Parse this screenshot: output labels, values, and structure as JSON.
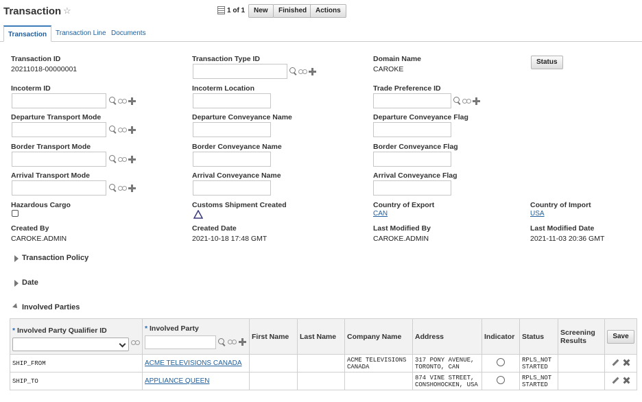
{
  "header": {
    "title": "Transaction",
    "record_nav": "1 of 1",
    "buttons": {
      "new": "New",
      "finished": "Finished",
      "actions": "Actions"
    }
  },
  "tabs": [
    "Transaction",
    "Transaction Line",
    "Documents"
  ],
  "form": {
    "transaction_id": {
      "label": "Transaction ID",
      "value": "20211018-00000001"
    },
    "transaction_type_id": {
      "label": "Transaction Type ID",
      "value": ""
    },
    "domain_name": {
      "label": "Domain Name",
      "value": "CAROKE"
    },
    "status_button": "Status",
    "incoterm_id": {
      "label": "Incoterm ID",
      "value": ""
    },
    "incoterm_location": {
      "label": "Incoterm Location",
      "value": ""
    },
    "trade_preference_id": {
      "label": "Trade Preference ID",
      "value": ""
    },
    "departure_transport_mode": {
      "label": "Departure Transport Mode",
      "value": ""
    },
    "departure_conveyance_name": {
      "label": "Departure Conveyance Name",
      "value": ""
    },
    "departure_conveyance_flag": {
      "label": "Departure Conveyance Flag",
      "value": ""
    },
    "border_transport_mode": {
      "label": "Border Transport Mode",
      "value": ""
    },
    "border_conveyance_name": {
      "label": "Border Conveyance Name",
      "value": ""
    },
    "border_conveyance_flag": {
      "label": "Border Conveyance Flag",
      "value": ""
    },
    "arrival_transport_mode": {
      "label": "Arrival Transport Mode",
      "value": ""
    },
    "arrival_conveyance_name": {
      "label": "Arrival Conveyance Name",
      "value": ""
    },
    "arrival_conveyance_flag": {
      "label": "Arrival Conveyance Flag",
      "value": ""
    },
    "hazardous_cargo": {
      "label": "Hazardous Cargo",
      "checked": false
    },
    "customs_shipment_created": {
      "label": "Customs Shipment Created"
    },
    "country_of_export": {
      "label": "Country of Export",
      "value": "CAN"
    },
    "country_of_import": {
      "label": "Country of Import",
      "value": "USA"
    },
    "created_by": {
      "label": "Created By",
      "value": "CAROKE.ADMIN"
    },
    "created_date": {
      "label": "Created Date",
      "value": "2021-10-18 17:48 GMT"
    },
    "last_modified_by": {
      "label": "Last Modified By",
      "value": "CAROKE.ADMIN"
    },
    "last_modified_date": {
      "label": "Last Modified Date",
      "value": "2021-11-03 20:36 GMT"
    }
  },
  "sections": {
    "transaction_policy": "Transaction Policy",
    "date": "Date",
    "involved_parties": "Involved Parties"
  },
  "involved_parties": {
    "columns": {
      "qualifier": "Involved Party Qualifier ID",
      "party": "Involved Party",
      "first_name": "First Name",
      "last_name": "Last Name",
      "company_name": "Company Name",
      "address": "Address",
      "indicator": "Indicator",
      "status": "Status",
      "screening_results": "Screening Results"
    },
    "save_button": "Save",
    "rows": [
      {
        "qualifier": "SHIP_FROM",
        "party": "ACME TELEVISIONS CANADA",
        "first_name": "",
        "last_name": "",
        "company_name": "ACME TELEVISIONS CANADA",
        "address": "317 PONY AVENUE, TORONTO, CAN",
        "status": "RPLS_NOT STARTED",
        "screening_results": ""
      },
      {
        "qualifier": "SHIP_TO",
        "party": "APPLIANCE QUEEN",
        "first_name": "",
        "last_name": "",
        "company_name": "",
        "address": "874 VINE STREET, CONSHOHOCKEN, USA",
        "status": "RPLS_NOT STARTED",
        "screening_results": ""
      }
    ]
  }
}
